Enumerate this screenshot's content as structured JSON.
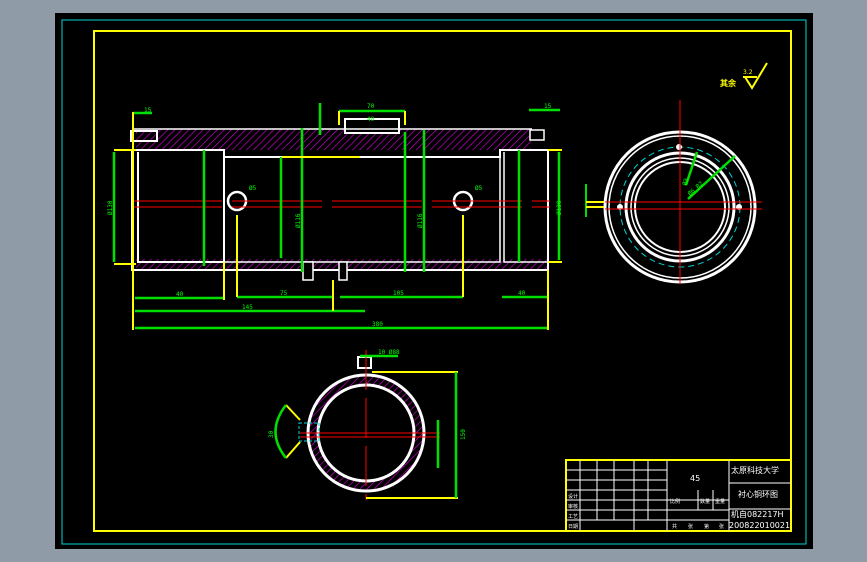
{
  "drawing": {
    "dimensions": {
      "d_top_left": "15",
      "d_keyway": "70",
      "d_keyway_inner": "40",
      "d_top_right": "15",
      "d_hole_left": "Ø5",
      "d_hole_right": "Ø5",
      "d_bottom_1": "40",
      "d_bottom_75": "75",
      "d_bottom_105": "105",
      "d_bottom_145": "145",
      "d_bottom_right": "40",
      "d_total": "380",
      "d_left_dia": "Ø130",
      "d_right_dia": "Ø130",
      "d_mid_dia_1": "Ø116",
      "d_mid_dia_2": "Ø116",
      "d_section_top": "10 Ø88",
      "d_section_height": "150",
      "d_section_left": "30",
      "d_end_view_1": "Ø3",
      "d_end_view_2": "Ø6 R2"
    },
    "roughness": {
      "value": "3.2",
      "other": "其余"
    },
    "title_block": {
      "material": "45",
      "school": "太原科技大学",
      "part_name": "衬心铜环图",
      "class": "机自082217H",
      "student_id": "200822010021",
      "scale_label": "比例",
      "qty_label": "数量",
      "weight_label": "重量",
      "sheet_labels": [
        "共",
        "张",
        "第",
        "张"
      ],
      "left_rows": [
        "设计",
        "审核",
        "工艺",
        "日期"
      ]
    }
  }
}
